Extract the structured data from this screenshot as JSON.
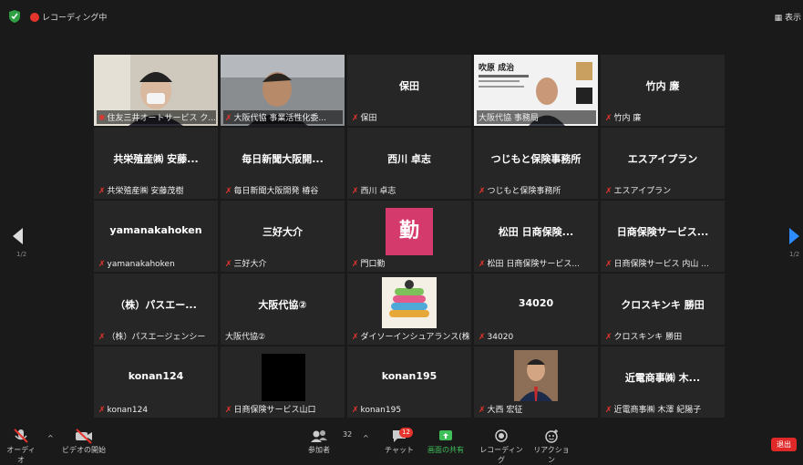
{
  "topbar": {
    "recording_label": "レコーディング中",
    "view_label": "表示"
  },
  "pagination": {
    "left": "1/2",
    "right": "1/2"
  },
  "tiles": [
    {
      "center": "",
      "name": "住友三井オートサービス ク..."
    },
    {
      "center": "",
      "name": "大阪代協 事業活性化委..."
    },
    {
      "center": "保田",
      "name": "保田"
    },
    {
      "center": "",
      "name": "大阪代協 事務局",
      "slide_title": "吹原 成治"
    },
    {
      "center": "竹内 廉",
      "name": "竹内 廉"
    },
    {
      "center": "共栄殖産㈱ 安藤...",
      "name": "共栄殖産㈱ 安藤茂樹"
    },
    {
      "center": "毎日新聞大阪開...",
      "name": "毎日新聞大阪開発 椿谷"
    },
    {
      "center": "西川 卓志",
      "name": "西川 卓志"
    },
    {
      "center": "つじもと保険事務所",
      "name": "つじもと保険事務所"
    },
    {
      "center": "エスアイプラン",
      "name": "エスアイプラン"
    },
    {
      "center": "yamanakahoken",
      "name": "yamanakahoken"
    },
    {
      "center": "三好大介",
      "name": "三好大介"
    },
    {
      "center": "勤",
      "name": "門口勤"
    },
    {
      "center": "松田 日商保険...",
      "name": "松田 日商保険サービス..."
    },
    {
      "center": "日商保険サービス...",
      "name": "日商保険サービス 内山 ..."
    },
    {
      "center": "（株）パスエー...",
      "name": "（株）パスエージェンシー"
    },
    {
      "center": "大阪代協②",
      "name": "大阪代協②"
    },
    {
      "center": "",
      "name": "ダイソーインシュアランス(株)..."
    },
    {
      "center": "34020",
      "name": "34020"
    },
    {
      "center": "クロスキンキ 勝田",
      "name": "クロスキンキ 勝田"
    },
    {
      "center": "konan124",
      "name": "konan124"
    },
    {
      "center": "",
      "name": "日商保険サービス山口"
    },
    {
      "center": "konan195",
      "name": "konan195"
    },
    {
      "center": "",
      "name": "大西 宏征"
    },
    {
      "center": "近電商事㈱ 木...",
      "name": "近電商事㈱ 木澤 紀陽子"
    }
  ],
  "toolbar": {
    "audio": "オーディオ",
    "video": "ビデオの開始",
    "participants": "参加者",
    "participants_count": "32",
    "chat": "チャット",
    "chat_badge": "12",
    "share": "画面の共有",
    "record": "レコーディング",
    "reactions": "リアクション",
    "exit": "退出"
  }
}
